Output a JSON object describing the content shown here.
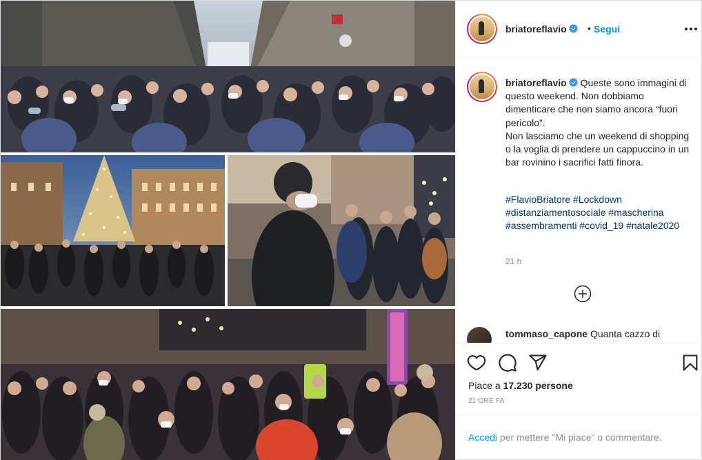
{
  "header": {
    "username": "briatoreflavio",
    "separator": "•",
    "follow_label": "Segui"
  },
  "caption": {
    "username": "briatoreflavio",
    "text": "Queste sono immagini di questo weekend. Non dobbiamo dimenticare che non siamo ancora “fuori pericolo”.\nNon lasciamo che un weekend di shopping o la voglia di prendere un cappuccino in un bar rovinino i sacrifici fatti finora.",
    "hashtags": [
      "#FlavioBriatore",
      "#Lockdown",
      "#distanziamentosociale",
      "#mascherina",
      "#assembramenti",
      "#covid_19",
      "#natale2020"
    ],
    "time_ago": "21 h"
  },
  "comment": {
    "username": "tommaso_capone",
    "text": "Quanta cazzo di"
  },
  "actions": {
    "likes_prefix": "Piace a",
    "likes_count": "17.230",
    "likes_suffix": "persone",
    "timestamp": "21 ORE FA"
  },
  "login_bar": {
    "link": "Accedi",
    "rest": "per mettere \"Mi piace\" o commentare."
  },
  "colors": {
    "link_blue": "#0095f6",
    "hashtag_blue": "#00376b",
    "muted": "#8e8e8e",
    "verified": "#3897f0"
  },
  "icons": [
    "verified-badge-icon",
    "more-options-icon",
    "load-more-icon",
    "heart-icon",
    "comment-icon",
    "share-icon",
    "bookmark-icon"
  ]
}
